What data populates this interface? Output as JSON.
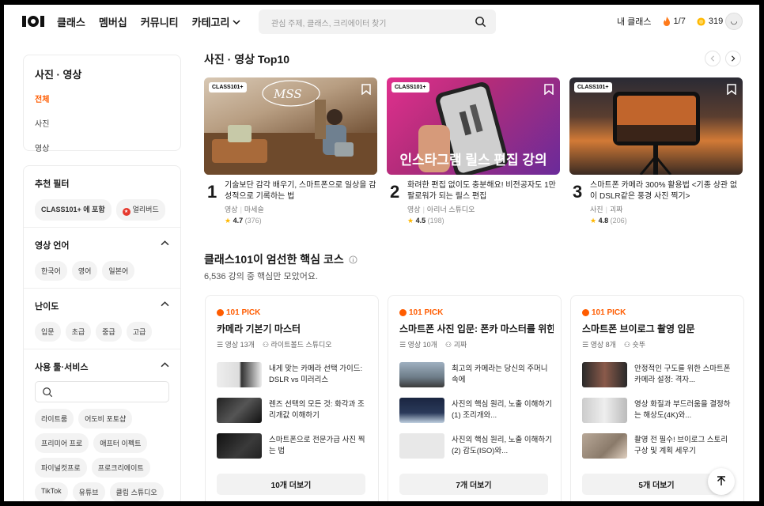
{
  "header": {
    "nav": [
      "클래스",
      "멤버십",
      "커뮤니티",
      "카테고리"
    ],
    "search_placeholder": "관심 주제, 클래스, 크리에이터 찾기",
    "my_class": "내 클래스",
    "streak": "1/7",
    "points": "319"
  },
  "sidebar": {
    "category_title": "사진 · 영상",
    "categories": [
      "전체",
      "사진",
      "영상"
    ],
    "filters": {
      "recommended_title": "추천 필터",
      "recommended": [
        "CLASS101+ 에 포함",
        "얼리버드"
      ],
      "language_title": "영상 언어",
      "languages": [
        "한국어",
        "영어",
        "일본어"
      ],
      "level_title": "난이도",
      "levels": [
        "입문",
        "초급",
        "중급",
        "고급"
      ],
      "tools_title": "사용 툴·서비스",
      "tools": [
        "라이트룸",
        "어도비 포토샵",
        "프리미어 프로",
        "애프터 이펙트",
        "파이널컷프로",
        "프로크리에이트",
        "TikTok",
        "유튜브",
        "클립 스튜디오"
      ]
    }
  },
  "top10": {
    "title": "사진 · 영상 Top10",
    "items": [
      {
        "rank": "1",
        "badge": "CLASS101+",
        "title": "기술보단 감각 배우기, 스마트폰으로 일상을 감성적으로 기록하는 법",
        "category": "영상",
        "creator": "마세슬",
        "rating": "4.7",
        "count": "(376)",
        "overlay": ""
      },
      {
        "rank": "2",
        "badge": "CLASS101+",
        "title": "화려한 편집 없이도 충분해요! 비전공자도 1만 팔로워가 되는 릴스 편집",
        "category": "영상",
        "creator": "아리너 스튜디오",
        "rating": "4.5",
        "count": "(198)",
        "overlay": "인스타그램 릴스 편집 강의"
      },
      {
        "rank": "3",
        "badge": "CLASS101+",
        "title": "스마트폰 카메라 300% 활용법 <기종 상관 없이 DSLR같은 풍경 사진 찍기>",
        "category": "사진",
        "creator": "괴짜",
        "rating": "4.8",
        "count": "(206)",
        "overlay": ""
      }
    ]
  },
  "picks": {
    "title": "클래스101이 엄선한 핵심 코스",
    "desc": "6,536 강의 중 핵심만 모았어요.",
    "label": "101 PICK",
    "cards": [
      {
        "title": "카메라 기본기 마스터",
        "count": "영상 13개",
        "creator": "라이트볼드 스튜디오",
        "lessons": [
          "내게 맞는 카메라 선택 가이드: DSLR vs 미러리스",
          "렌즈 선택의 모든 것: 화각과 조리개값 이해하기",
          "스마트폰으로 전문가급 사진 찍는 법"
        ],
        "more": "10개 더보기"
      },
      {
        "title": "스마트폰 사진 입문: 폰카 마스터를 위한...",
        "count": "영상 10개",
        "creator": "괴짜",
        "lessons": [
          "최고의 카메라는 당신의 주머니 속에",
          "사진의 핵심 원리, 노출 이해하기 (1) 조리개와...",
          "사진의 핵심 원리, 노출 이해하기 (2) 감도(ISO)와..."
        ],
        "more": "7개 더보기"
      },
      {
        "title": "스마트폰 브이로그 촬영 입문",
        "count": "영상 8개",
        "creator": "숏뚜",
        "lessons": [
          "안정적인 구도를 위한 스마트폰 카메라 설정: 격자...",
          "영상 화질과 부드러움을 결정하는 해상도(4K)와...",
          "촬영 전 필수! 브이로그 스토리 구상 및 계획 세우기"
        ],
        "more": "5개 더보기"
      }
    ]
  }
}
